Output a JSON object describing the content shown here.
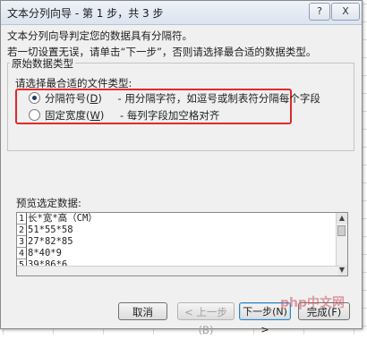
{
  "window": {
    "title": "文本分列向导 - 第 1 步，共 3 步",
    "help_label": "?",
    "close_label": "X"
  },
  "intro": {
    "line1": "文本分列向导判定您的数据具有分隔符。",
    "line2": "若一切设置无误，请单击“下一步”，否则请选择最合适的数据类型。"
  },
  "data_type_group": {
    "legend": "原始数据类型",
    "hint": "请选择最合适的文件类型:",
    "options": [
      {
        "label": "分隔符号(",
        "hotkey": "D",
        "label_end": ")",
        "description": "- 用分隔字符，如逗号或制表符分隔每个字段",
        "selected": true
      },
      {
        "label": "固定宽度(",
        "hotkey": "W",
        "label_end": ")",
        "description": "- 每列字段加空格对齐",
        "selected": false
      }
    ]
  },
  "preview": {
    "label": "预览选定数据:",
    "rows": [
      {
        "num": "1",
        "text": "长*宽*高（CM）"
      },
      {
        "num": "2",
        "text": "51*55*58"
      },
      {
        "num": "3",
        "text": "27*82*85"
      },
      {
        "num": "4",
        "text": "8*40*9"
      },
      {
        "num": "5",
        "text": "39*86*6"
      }
    ]
  },
  "buttons": {
    "cancel": "取消",
    "prev": "< 上一步(B)",
    "next": "下一步(N) >",
    "finish": "完成(F)"
  },
  "watermark": "php中文网",
  "colors": {
    "highlight_border": "#e02a2a",
    "dialog_bg": "#f0f0f0"
  }
}
